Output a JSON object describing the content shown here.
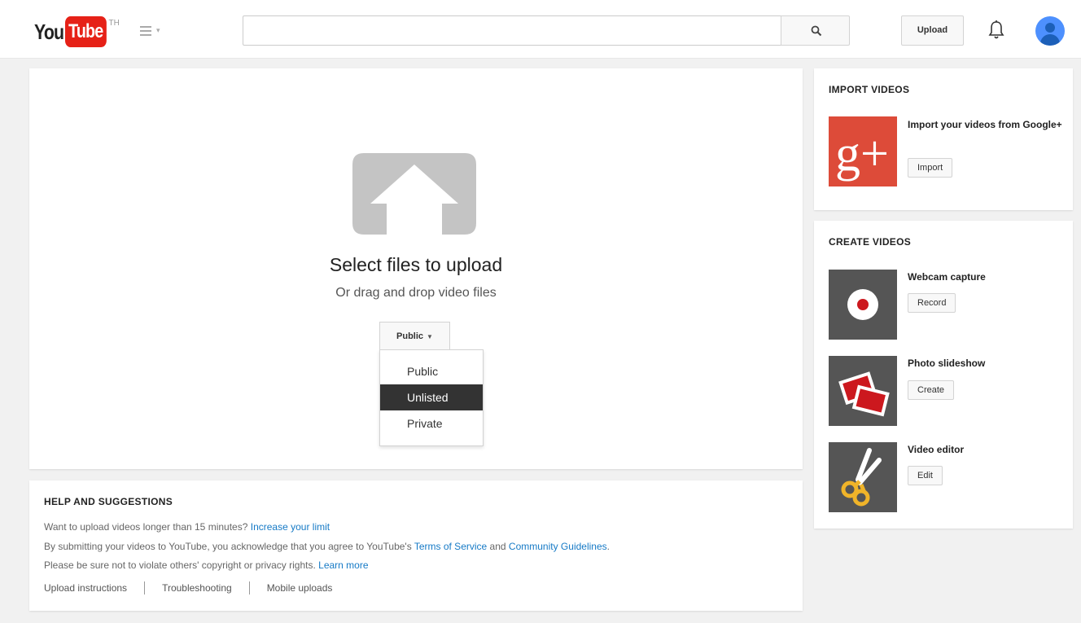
{
  "header": {
    "logo_you": "You",
    "logo_tube": "Tube",
    "logo_region": "TH",
    "search": {
      "value": "",
      "placeholder": ""
    },
    "upload_label": "Upload"
  },
  "upload": {
    "title": "Select files to upload",
    "subtitle": "Or drag and drop video files",
    "privacy": {
      "selected_label": "Public",
      "options": [
        "Public",
        "Unlisted",
        "Private"
      ],
      "highlighted": "Unlisted"
    }
  },
  "help": {
    "title": "HELP AND SUGGESTIONS",
    "line1_text": "Want to upload videos longer than 15 minutes?",
    "line1_link": "Increase your limit",
    "line2_text": "By submitting your videos to YouTube, you acknowledge that you agree to YouTube's",
    "line2_tos": "Terms of Service",
    "line2_and": "and",
    "line2_guidelines": "Community Guidelines",
    "line2_end": ".",
    "line3_text": "Please be sure not to violate others' copyright or privacy rights.",
    "line3_link": "Learn more",
    "links": [
      "Upload instructions",
      "Troubleshooting",
      "Mobile uploads"
    ]
  },
  "import_videos": {
    "title": "IMPORT VIDEOS",
    "item_title": "Import your videos from Google+",
    "button": "Import",
    "thumb_text": "g+"
  },
  "create_videos": {
    "title": "CREATE VIDEOS",
    "items": [
      {
        "title": "Webcam capture",
        "button": "Record",
        "icon": "webcam-record-icon"
      },
      {
        "title": "Photo slideshow",
        "button": "Create",
        "icon": "photo-slideshow-icon"
      },
      {
        "title": "Video editor",
        "button": "Edit",
        "icon": "scissors-icon"
      }
    ]
  },
  "colors": {
    "brand_red": "#e62117",
    "link_blue": "#167ac6",
    "google_plus_red": "#dd4b39",
    "menu_selected_bg": "#333333",
    "thumb_gray": "#555555"
  }
}
